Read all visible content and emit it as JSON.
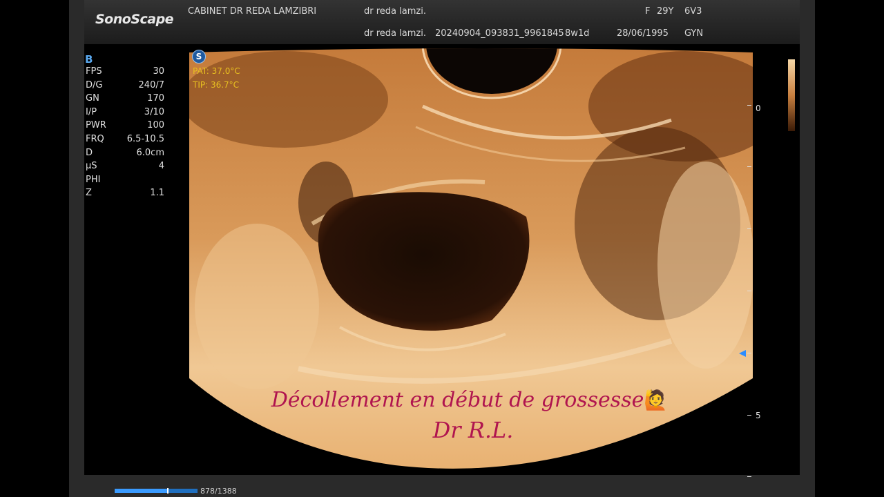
{
  "header": {
    "logo": "SonoScape",
    "clinic": "CABINET DR REDA LAMZIBRI",
    "operator_top": "dr reda lamzi.",
    "operator_bottom": "dr reda lamzi.",
    "exam_id": "20240904_093831_9961845",
    "gestation": "8w1d",
    "birth_date": "28/06/1995",
    "sex": "F",
    "age": "29Y",
    "probe": "6V3",
    "preset": "GYN"
  },
  "params": {
    "mode": "B",
    "rows": [
      {
        "key": "FPS",
        "value": "30"
      },
      {
        "key": "D/G",
        "value": "240/7"
      },
      {
        "key": "GN",
        "value": "170"
      },
      {
        "key": "I/P",
        "value": "3/10"
      },
      {
        "key": "PWR",
        "value": "100"
      },
      {
        "key": "FRQ",
        "value": "6.5-10.5"
      },
      {
        "key": "D",
        "value": "6.0cm"
      },
      {
        "key": "µS",
        "value": "4"
      },
      {
        "key": "PHI",
        "value": ""
      },
      {
        "key": "Z",
        "value": "1.1"
      }
    ]
  },
  "temps": {
    "pat": "PAT:  37.0°C",
    "tip": "TIP:  36.7°C"
  },
  "depth_scale": {
    "label_top": "0",
    "label_mid": "5"
  },
  "overlay": {
    "line1": "Décollement en début de grossesse",
    "emoji": "🙋",
    "line2": "Dr R.L."
  },
  "playback": {
    "text": "878/1388",
    "fraction": 0.633
  },
  "colors": {
    "tissue": "#e8b070",
    "caption": "#b0154f",
    "accent_blue": "#3a9bff",
    "temp": "#e8c020"
  }
}
